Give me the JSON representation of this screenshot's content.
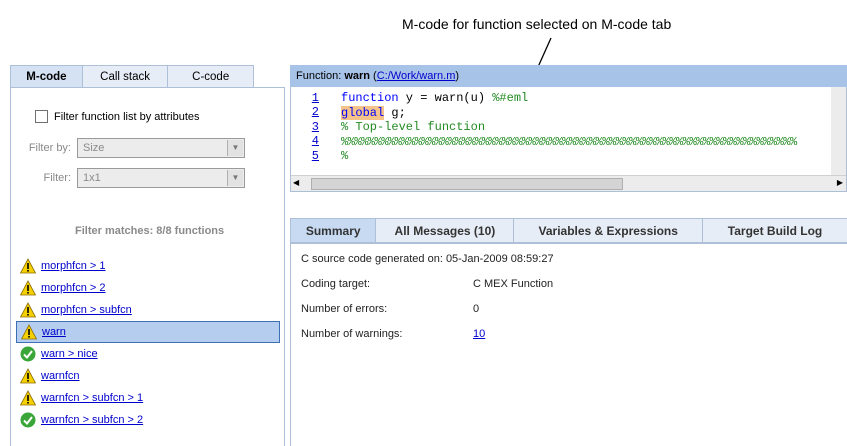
{
  "callout": "M-code for function selected on M-code tab",
  "left": {
    "tabs": [
      "M-code",
      "Call stack",
      "C-code"
    ],
    "filter_checkbox_label": "Filter function list by attributes",
    "filter_by_label": "Filter by:",
    "filter_by_value": "Size",
    "filter_label": "Filter:",
    "filter_value": "1x1",
    "matches": "Filter matches: 8/8 functions",
    "functions": [
      {
        "name": "morphfcn > 1",
        "status": "warning"
      },
      {
        "name": "morphfcn > 2",
        "status": "warning"
      },
      {
        "name": "morphfcn > subfcn",
        "status": "warning"
      },
      {
        "name": "warn",
        "status": "warning",
        "selected": true
      },
      {
        "name": "warn > nice",
        "status": "ok"
      },
      {
        "name": "warnfcn",
        "status": "warning"
      },
      {
        "name": "warnfcn > subfcn > 1",
        "status": "warning"
      },
      {
        "name": "warnfcn > subfcn > 2",
        "status": "ok"
      }
    ]
  },
  "right": {
    "fn_prefix": "Function: ",
    "fn_name": "warn",
    "fn_path": "C:/Work/warn.m",
    "code": {
      "l1_num": "1",
      "l1_kw": "function",
      "l1_rest": " y = warn(u) ",
      "l1_cm": "%#eml",
      "l2_num": "2",
      "l2_hl": "global",
      "l2_rest": " g;",
      "l3_num": "3",
      "l3_cm": "% Top-level function",
      "l4_num": "4",
      "l4_cm": "%%%%%%%%%%%%%%%%%%%%%%%%%%%%%%%%%%%%%%%%%%%%%%%%%%%%%%%%%%%%%%%%%%%%",
      "l5_num": "5",
      "l5_cm": "%"
    },
    "tabs": [
      "Summary",
      "All Messages (10)",
      "Variables & Expressions",
      "Target Build Log"
    ],
    "summary": {
      "generated_label": "C source code generated on:",
      "generated_value": "05-Jan-2009 08:59:27",
      "target_label": "Coding target:",
      "target_value": "C MEX Function",
      "errors_label": "Number of errors:",
      "errors_value": "0",
      "warnings_label": "Number of warnings:",
      "warnings_value": "10"
    }
  },
  "colors": {
    "warning": "#f5d000",
    "ok": "#3aa63a",
    "tab_bar": "#a8c3e8"
  }
}
